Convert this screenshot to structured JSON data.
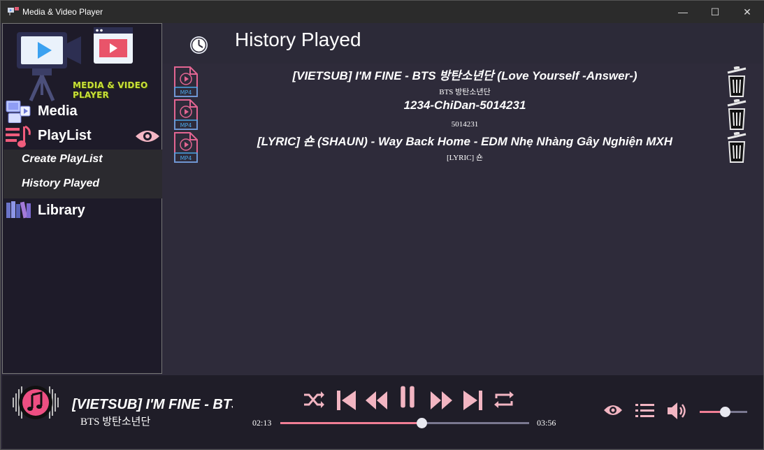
{
  "window": {
    "title": "Media & Video Player",
    "controls": {
      "minimize": "—",
      "maximize": "☐",
      "close": "✕"
    }
  },
  "sidebar": {
    "logo_text": "MEDIA & VIDEO PLAYER",
    "items": {
      "media": {
        "label": "Media",
        "icon": "media-icon"
      },
      "playlist": {
        "label": "PlayList",
        "icon": "playlist-icon",
        "action_icon": "eye-icon"
      },
      "library": {
        "label": "Library",
        "icon": "books-icon"
      }
    },
    "submenu": [
      {
        "label": "Create PlayList"
      },
      {
        "label": "History Played"
      }
    ]
  },
  "main": {
    "title": "History Played",
    "title_icon": "clock-icon",
    "items": [
      {
        "title": "[VIETSUB] I'M FINE - BTS 방탄소년단 (Love Yourself -Answer-)",
        "artist": "BTS 방탄소년단",
        "format": "MP4"
      },
      {
        "title": "1234-ChiDan-5014231",
        "artist": "5014231",
        "format": "MP4"
      },
      {
        "title": "[LYRIC] 숀 (SHAUN) - Way Back Home - EDM Nhẹ Nhàng Gây Nghiện MXH",
        "artist": "[LYRIC] 숀",
        "format": "MP4"
      }
    ]
  },
  "player": {
    "now_title": "[VIETSUB] I'M FINE - BTS 방탄소년단 (Love Yourself -Answer-)",
    "now_artist": "BTS 방탄소년단",
    "elapsed": "02:13",
    "total": "03:56",
    "progress": 0.57,
    "volume": 0.54,
    "accent": "#f07e95"
  }
}
